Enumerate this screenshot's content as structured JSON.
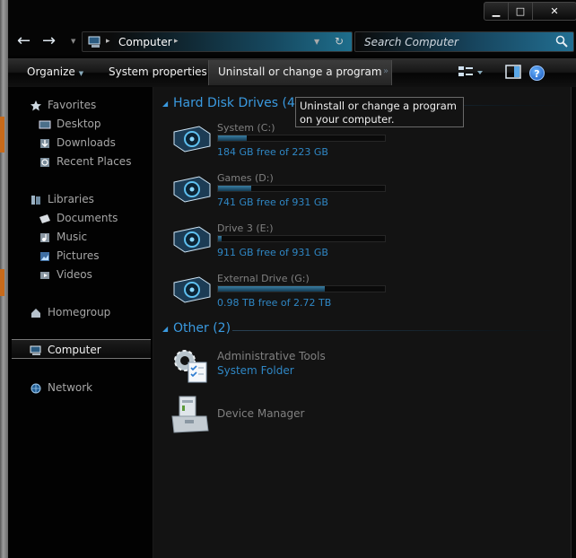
{
  "window": {
    "caption_buttons": {
      "minimize": "▁",
      "maximize": "□",
      "close": "✕"
    }
  },
  "nav": {
    "back_icon": "arrow-left-icon",
    "forward_icon": "arrow-right-icon",
    "address_crumb": "Computer",
    "search_placeholder": "Search Computer"
  },
  "toolbar": {
    "organize": "Organize",
    "system_properties": "System properties",
    "uninstall": "Uninstall or change a program",
    "more": "»",
    "help": "?"
  },
  "sidebar": {
    "favorites": "Favorites",
    "favorites_items": [
      "Desktop",
      "Downloads",
      "Recent Places"
    ],
    "libraries": "Libraries",
    "libraries_items": [
      "Documents",
      "Music",
      "Pictures",
      "Videos"
    ],
    "homegroup": "Homegroup",
    "computer": "Computer",
    "network": "Network"
  },
  "main": {
    "hdd_group": "Hard Disk Drives (4)",
    "drives": [
      {
        "name": "System (C:)",
        "free": "184 GB free of 223 GB",
        "used_fraction": 0.17
      },
      {
        "name": "Games (D:)",
        "free": "741 GB free of 931 GB",
        "used_fraction": 0.2
      },
      {
        "name": "Drive 3 (E:)",
        "free": "911 GB free of 931 GB",
        "used_fraction": 0.02
      },
      {
        "name": "External Drive (G:)",
        "free": "0.98 TB free of 2.72 TB",
        "used_fraction": 0.64
      }
    ],
    "other_group": "Other (2)",
    "other_items": [
      {
        "name": "Administrative Tools",
        "sub": "System Folder"
      },
      {
        "name": "Device Manager",
        "sub": ""
      }
    ]
  },
  "tooltip": "Uninstall or change a program on your computer.",
  "colors": {
    "accent": "#3a9ae0",
    "link": "#2f87c5",
    "background": "#131313"
  }
}
